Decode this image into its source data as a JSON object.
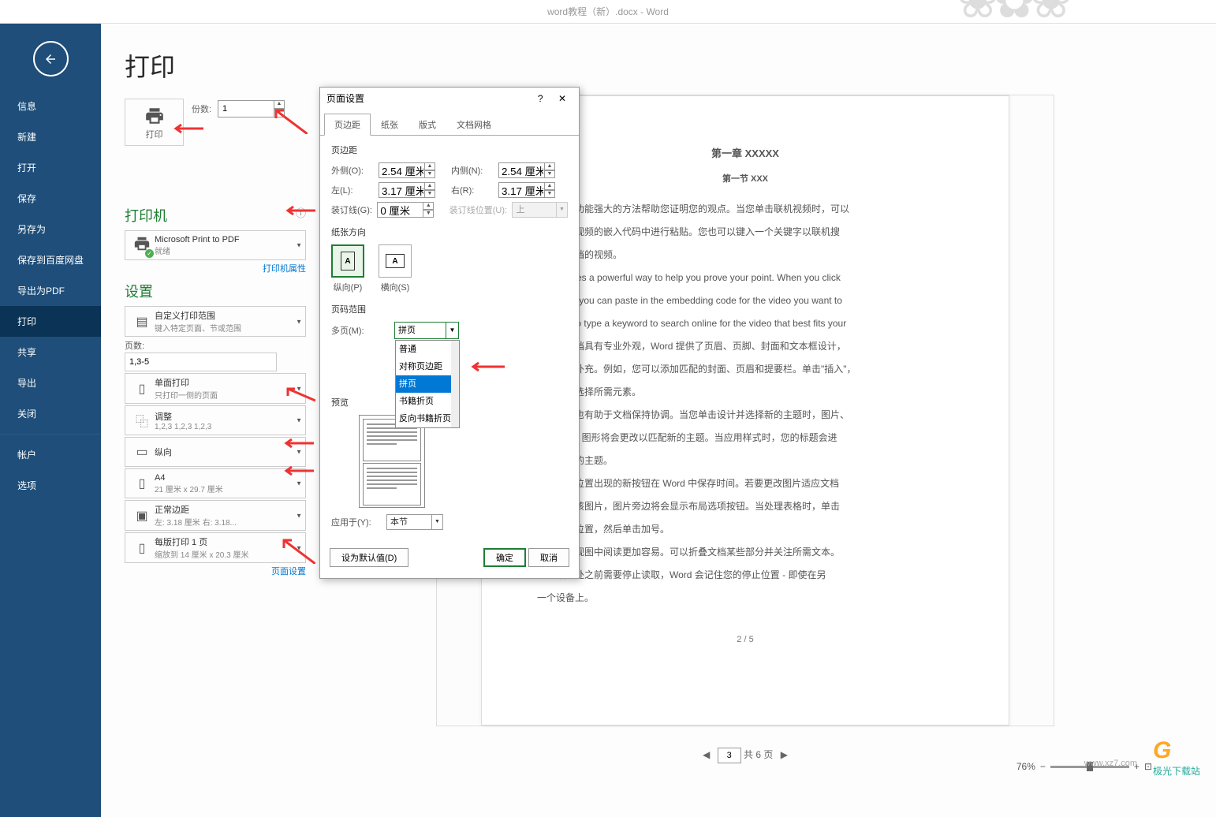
{
  "app_title": "word教程（新）.docx - Word",
  "sidebar": {
    "items": [
      "信息",
      "新建",
      "打开",
      "保存",
      "另存为",
      "保存到百度网盘",
      "导出为PDF",
      "打印",
      "共享",
      "导出",
      "关闭"
    ],
    "account": "帐户",
    "options": "选项",
    "active": "打印"
  },
  "page": {
    "heading": "打印",
    "print_btn": "打印",
    "copies_label": "份数:",
    "copies_value": "1"
  },
  "printer": {
    "heading": "打印机",
    "name": "Microsoft Print to PDF",
    "status": "就绪",
    "props_link": "打印机属性"
  },
  "settings": {
    "heading": "设置",
    "range_title": "自定义打印范围",
    "range_sub": "键入特定页面、节或范围",
    "pages_label": "页数:",
    "pages_value": "1,3-5",
    "side_title": "单面打印",
    "side_sub": "只打印一侧的页面",
    "collate_title": "调整",
    "collate_sub": "1,2,3    1,2,3    1,2,3",
    "orient": "纵向",
    "paper_title": "A4",
    "paper_sub": "21 厘米 x 29.7 厘米",
    "margin_title": "正常边距",
    "margin_sub": "左:  3.18 厘米    右:  3.18...",
    "sheet_title": "每版打印 1 页",
    "sheet_sub": "缩放到 14 厘米 x 20.3 厘米",
    "page_setup_link": "页面设置"
  },
  "dialog": {
    "title": "页面设置",
    "tabs": [
      "页边距",
      "纸张",
      "版式",
      "文档网格"
    ],
    "margins_label": "页边距",
    "outer_lbl": "外侧(O):",
    "outer_val": "2.54 厘米",
    "inner_lbl": "内侧(N):",
    "inner_val": "2.54 厘米",
    "left_lbl": "左(L):",
    "left_val": "3.17 厘米",
    "right_lbl": "右(R):",
    "right_val": "3.17 厘米",
    "gutter_lbl": "装订线(G):",
    "gutter_val": "0 厘米",
    "gutter_pos_lbl": "装订线位置(U):",
    "gutter_pos_val": "上",
    "orient_label": "纸张方向",
    "portrait": "纵向(P)",
    "landscape": "横向(S)",
    "range_label": "页码范围",
    "multipage_lbl": "多页(M):",
    "multipage_val": "拼页",
    "multipage_options": [
      "普通",
      "对称页边距",
      "拼页",
      "书籍折页",
      "反向书籍折页"
    ],
    "preview_label": "预览",
    "apply_lbl": "应用于(Y):",
    "apply_val": "本节",
    "default_btn": "设为默认值(D)",
    "ok_btn": "确定",
    "cancel_btn": "取消"
  },
  "doc": {
    "h3": "第一章 XXXXX",
    "h4": "第一节 XXX",
    "p1": "供了功能强大的方法帮助您证明您的观点。当您单击联机视频时，可以",
    "p2": "加的视频的嵌入代码中进行粘贴。您也可以键入一个关键字以联机搜",
    "p3": "的文档的视频。",
    "p4": "rovides a powerful way to help you prove your point. When you click",
    "p5": "ideo, you can paste in the embedding code for the video you want to",
    "p6": "n also type a keyword to search online for the video that best fits your",
    "p7": "的文档具有专业外观，Word 提供了页眉、页脚、封面和文本框设计，",
    "p8": "互为补充。例如，您可以添加匹配的封面、页眉和提要栏。单击\"插入\"，",
    "p9": "库中选择所需元素。",
    "p10": "样式也有助于文档保持协调。当您单击设计并选择新的主题时，图片、",
    "p11": "artArt 图形将会更改以匹配新的主题。当应用样式时，您的标题会进",
    "p12": "配新的主题。",
    "p13": "需要位置出现的新按钮在 Word 中保存时间。若要更改图片适应文档",
    "p14": "单击该图片，图片旁边将会显示布局选项按钮。当处理表格时，单击",
    "p15": "列的位置，然后单击加号。",
    "p16": "阅读视图中阅读更加容易。可以折叠文档某些部分并关注所需文本。",
    "p17": "结尾处之前需要停止读取，Word 会记住您的停止位置 - 即使在另",
    "p18": "一个设备上。",
    "pgnum": "2 / 5"
  },
  "footer": {
    "page_input": "3",
    "total": "共 6 页",
    "zoom": "76%"
  },
  "watermark": {
    "site": "极光下载站",
    "url": "www.xz7.com"
  }
}
